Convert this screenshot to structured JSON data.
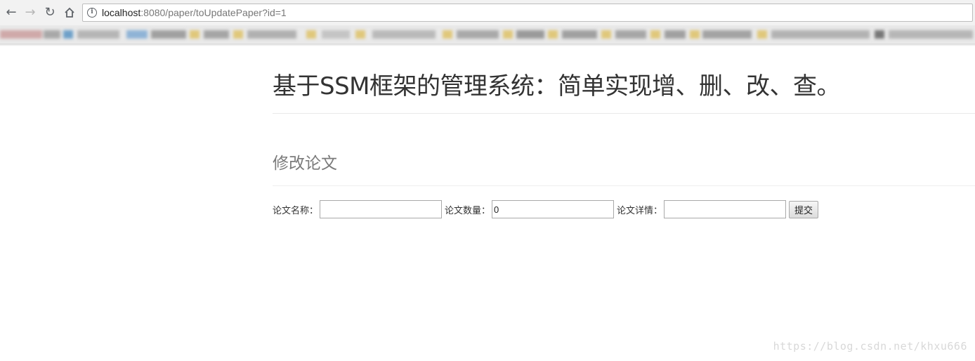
{
  "browser": {
    "url_host": "localhost",
    "url_rest": ":8080/paper/toUpdatePaper?id=1",
    "icons": [
      "back-icon",
      "forward-icon",
      "reload-icon",
      "home-icon",
      "info-icon"
    ]
  },
  "page": {
    "title": "基于SSM框架的管理系统：简单实现增、删、改、查。",
    "section_title": "修改论文"
  },
  "form": {
    "name_label": "论文名称：",
    "name_value": "",
    "count_label": "论文数量：",
    "count_value": "0",
    "detail_label": "论文详情：",
    "detail_value": "",
    "submit_label": "提交"
  },
  "watermark": "https://blog.csdn.net/khxu666",
  "colors": {
    "title_text": "#333333",
    "section_text": "#7a7a7a",
    "divider": "#e9e9e9"
  }
}
